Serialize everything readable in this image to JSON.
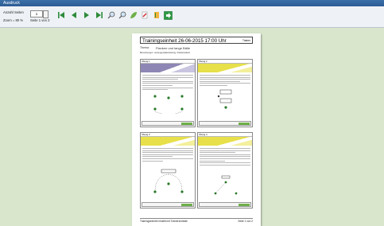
{
  "window": {
    "title": "Ausdruck"
  },
  "toolbar": {
    "pages_label": "Anzahl Seiten",
    "pages_value": "1",
    "zoom_label": "Zoom = 80 %",
    "page_info": "Seite 1 von 2"
  },
  "document": {
    "title": "Trainingseinheit 26-06-2015 17:00 Uhr",
    "title_right": "Trainer",
    "theme_label": "Thema:",
    "theme_value": "Flanken und lange Bälle",
    "notes": "Bemerkungen:   vorrangig Hallentraining / Flankenarbeit",
    "footer_left": "Trainingseinheit erstellt mit Trainerzentrale",
    "footer_right": "Seite 1 von 2"
  },
  "cards": [
    {
      "header": "Übung 1",
      "band": "#8e86b4"
    },
    {
      "header": "Übung 2",
      "band": "#e7e04a"
    },
    {
      "header": "Übung 3",
      "band": "#e7e04a"
    },
    {
      "header": "Übung 4",
      "band": "#e7e04a"
    }
  ]
}
